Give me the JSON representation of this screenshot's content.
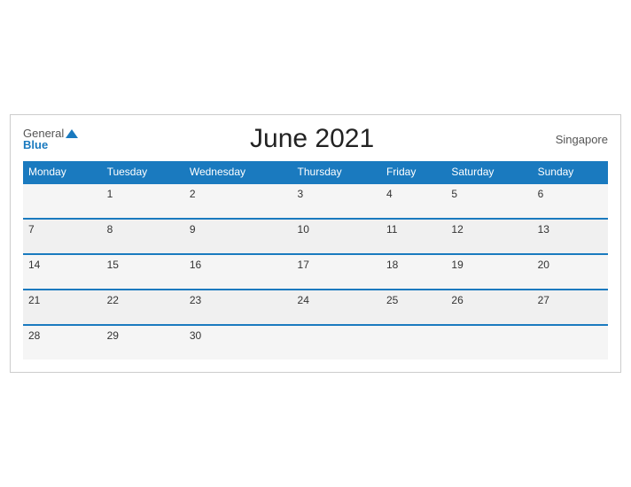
{
  "header": {
    "logo_general": "General",
    "logo_blue": "Blue",
    "title": "June 2021",
    "country": "Singapore"
  },
  "weekdays": [
    "Monday",
    "Tuesday",
    "Wednesday",
    "Thursday",
    "Friday",
    "Saturday",
    "Sunday"
  ],
  "weeks": [
    [
      "",
      "1",
      "2",
      "3",
      "4",
      "5",
      "6"
    ],
    [
      "7",
      "8",
      "9",
      "10",
      "11",
      "12",
      "13"
    ],
    [
      "14",
      "15",
      "16",
      "17",
      "18",
      "19",
      "20"
    ],
    [
      "21",
      "22",
      "23",
      "24",
      "25",
      "26",
      "27"
    ],
    [
      "28",
      "29",
      "30",
      "",
      "",
      "",
      ""
    ]
  ]
}
